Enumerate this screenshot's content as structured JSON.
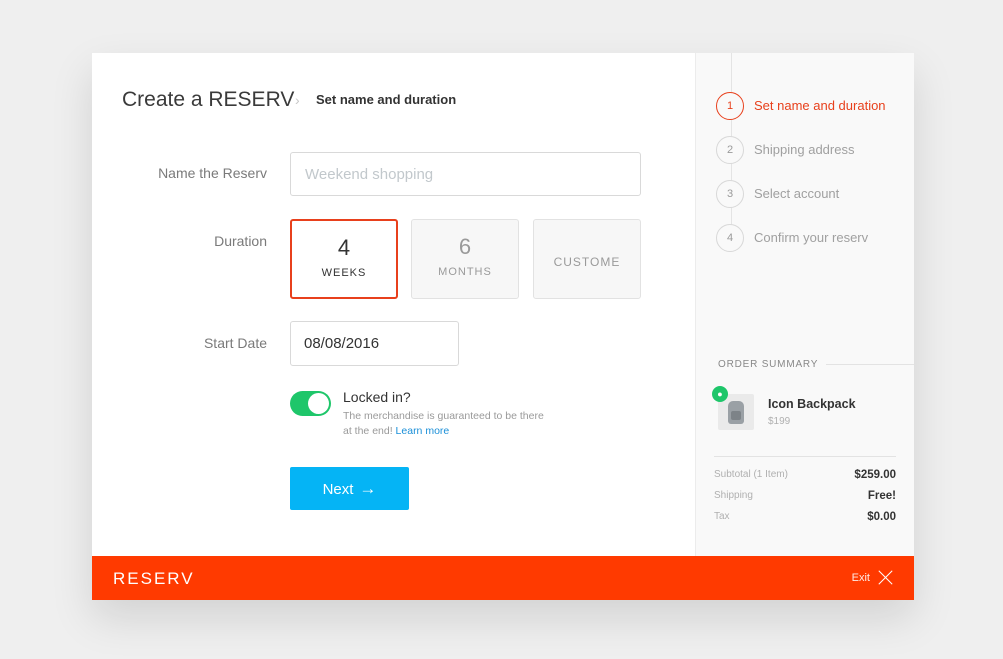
{
  "header": {
    "title": "Create a RESERV",
    "separator": "›",
    "breadcrumb": "Set name and duration"
  },
  "form": {
    "name_label": "Name the Reserv",
    "name_placeholder": "Weekend shopping",
    "name_value": "",
    "duration_label": "Duration",
    "durations": [
      {
        "num": "4",
        "unit": "WEEKS",
        "selected": true
      },
      {
        "num": "6",
        "unit": "MONTHS",
        "selected": false
      },
      {
        "label": "CUSTOME",
        "selected": false
      }
    ],
    "start_date_label": "Start Date",
    "start_date_value": "08/08/2016",
    "locked": {
      "on": true,
      "title": "Locked in?",
      "description": "The merchandise is guaranteed to be there at the end!",
      "link": "Learn more"
    },
    "next_label": "Next",
    "next_arrow": "→"
  },
  "steps": [
    {
      "num": "1",
      "label": "Set name and duration",
      "active": true
    },
    {
      "num": "2",
      "label": "Shipping address",
      "active": false
    },
    {
      "num": "3",
      "label": "Select account",
      "active": false
    },
    {
      "num": "4",
      "label": "Confirm your reserv",
      "active": false
    }
  ],
  "order_summary": {
    "title": "ORDER SUMMARY",
    "item": {
      "name": "Icon Backpack",
      "price": "$199",
      "icon": "backpack-icon",
      "badge_icon": "lock-icon"
    },
    "rows": [
      {
        "key": "Subtotal (1 Item)",
        "value": "$259.00"
      },
      {
        "key": "Shipping",
        "value": "Free!"
      },
      {
        "key": "Tax",
        "value": "$0.00"
      }
    ]
  },
  "footer": {
    "logo": "RESERV",
    "exit_label": "Exit",
    "exit_icon": "close-icon"
  },
  "colors": {
    "accent": "#ff3a00",
    "active_border": "#e8401c",
    "button": "#05b4f5",
    "toggle": "#1ec66a",
    "link": "#1a8fd8"
  }
}
